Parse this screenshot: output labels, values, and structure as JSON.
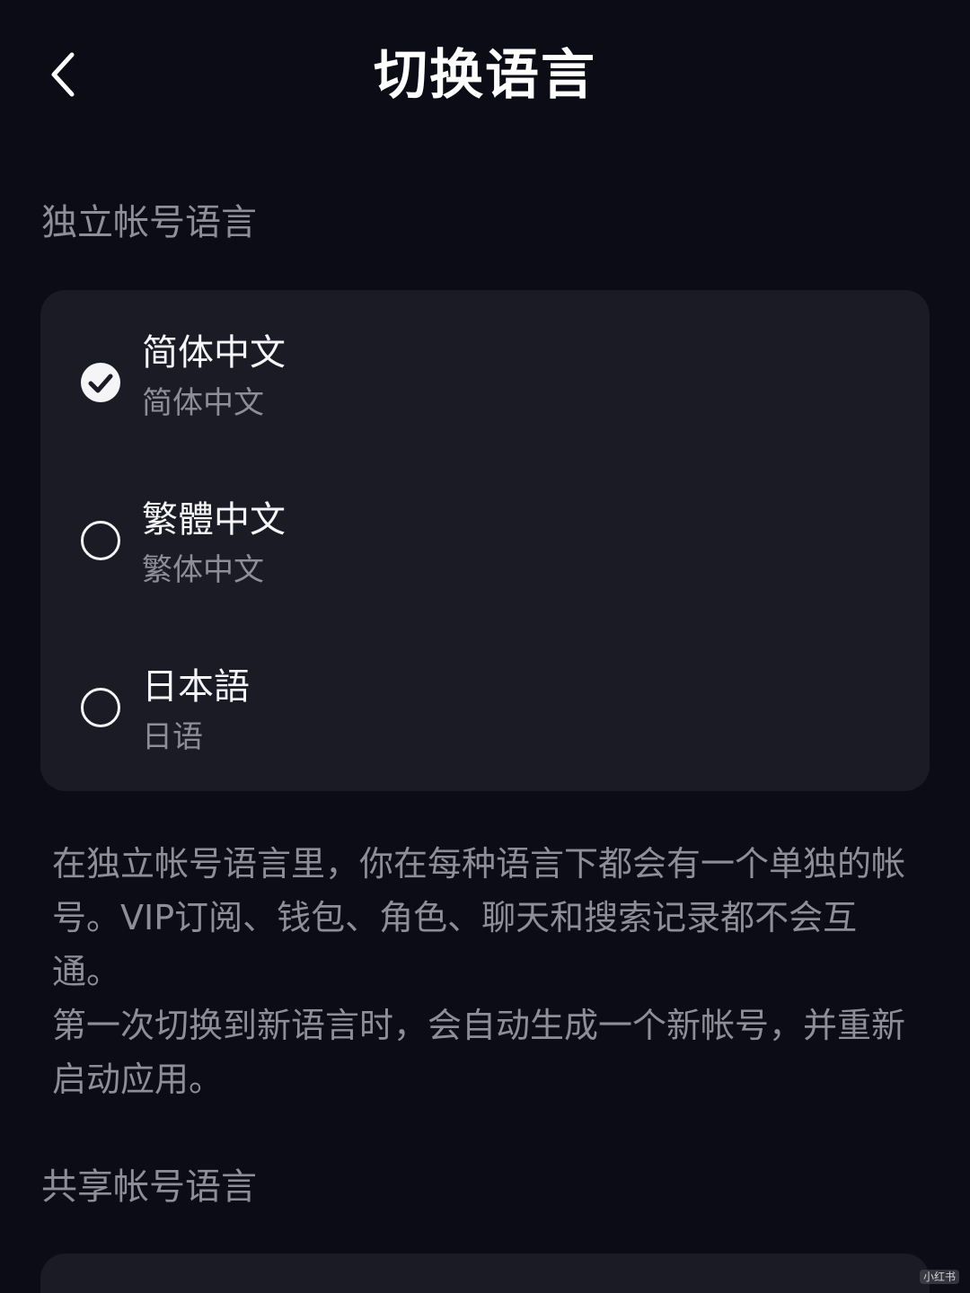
{
  "header": {
    "title": "切换语言",
    "back_icon": "chevron-left-icon"
  },
  "independent": {
    "label": "独立帐号语言",
    "items": [
      {
        "name": "简体中文",
        "sub": "简体中文",
        "selected": true
      },
      {
        "name": "繁體中文",
        "sub": "繁体中文",
        "selected": false
      },
      {
        "name": "日本語",
        "sub": "日语",
        "selected": false
      }
    ],
    "description": [
      "在独立帐号语言里，你在每种语言下都会有一个单独的帐号。VIP订阅、钱包、角色、聊天和搜索记录都不会互通。",
      "第一次切换到新语言时，会自动生成一个新帐号，并重新启动应用。"
    ]
  },
  "shared": {
    "label": "共享帐号语言"
  },
  "watermark": "小红书",
  "colors": {
    "background": "#0c0c17",
    "card": "#1b1b26",
    "text_primary": "#f5f5f7",
    "text_secondary": "#8e8e98"
  }
}
